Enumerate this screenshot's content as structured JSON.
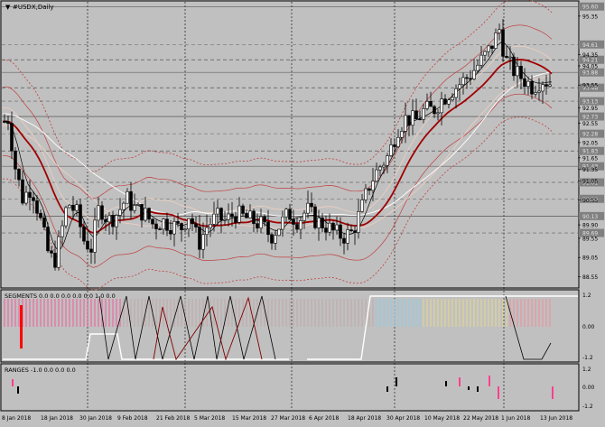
{
  "window": {
    "title": "#USDX,Daily",
    "menu_icon": "triangle-down-icon"
  },
  "main_chart": {
    "price_labels": [
      "95.35",
      "94.61",
      "94.35",
      "94.05",
      "93.88",
      "93.55",
      "93.48",
      "93.13",
      "92.95",
      "92.55",
      "92.32",
      "92.05",
      "91.65",
      "91.35",
      "91.05",
      "90.88",
      "90.55",
      "90.13",
      "89.90",
      "89.55",
      "89.05",
      "88.55"
    ],
    "highlighted_prices": [
      "95.60",
      "94.61",
      "94.21",
      "93.88",
      "93.48",
      "93.13",
      "92.73",
      "92.28",
      "91.83",
      "91.43",
      "91.01",
      "90.58",
      "90.13",
      "89.69"
    ]
  },
  "segments_panel": {
    "title": "SEGMENTS 0.0 0.0 0.0 0.0 0.0 1.0 0.0",
    "scale_labels": [
      "1.2",
      "0.00",
      "-1.2"
    ]
  },
  "ranges_panel": {
    "title": "RANGES -1.0 0.0 0.0 0.0",
    "scale_labels": [
      "1.2",
      "0.00",
      "-1.2"
    ]
  },
  "time_axis": {
    "labels": [
      "8 Jan 2018",
      "18 Jan 2018",
      "30 Jan 2018",
      "9 Feb 2018",
      "21 Feb 2018",
      "5 Mar 2018",
      "15 Mar 2018",
      "27 Mar 2018",
      "6 Apr 2018",
      "18 Apr 2018",
      "30 Apr 2018",
      "10 May 2018",
      "22 May 2018",
      "1 Jun 2018",
      "13 Jun 2018"
    ]
  },
  "colors": {
    "background": "#c0c0c0",
    "candle": "#000000",
    "ma_dark_red": "#a00000",
    "band_red": "#c04040",
    "band_light": "#f0d0c0",
    "white_line": "#ffffff",
    "segment_pink": "#ff4090",
    "segment_cyan": "#80d0f0",
    "segment_yellow": "#f0e080",
    "price_box": "#808080"
  },
  "chart_data": {
    "type": "candlestick",
    "series": [
      {
        "name": "#USDX,Daily",
        "values": []
      }
    ],
    "ylim": [
      88.3,
      95.7
    ]
  }
}
